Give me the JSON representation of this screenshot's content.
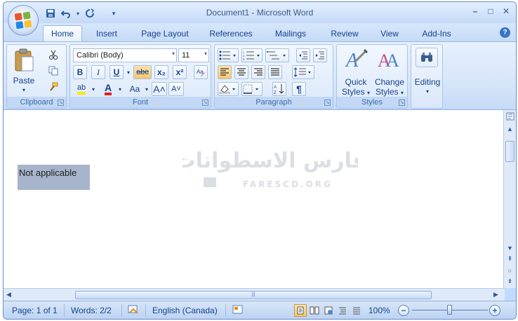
{
  "window": {
    "title": "Document1 - Microsoft Word",
    "controls": {
      "minimize": "–",
      "restore": "□",
      "close": "✕"
    }
  },
  "qat": {
    "more": "▾"
  },
  "tabs": [
    {
      "label": "Home",
      "active": true
    },
    {
      "label": "Insert"
    },
    {
      "label": "Page Layout"
    },
    {
      "label": "References"
    },
    {
      "label": "Mailings"
    },
    {
      "label": "Review"
    },
    {
      "label": "View"
    },
    {
      "label": "Add-Ins"
    }
  ],
  "help": "?",
  "ribbon": {
    "clipboard": {
      "label": "Clipboard",
      "paste": "Paste"
    },
    "font": {
      "label": "Font",
      "font_name": "Calibri (Body)",
      "font_size": "11",
      "bold": "B",
      "italic": "I",
      "underline": "U",
      "strike": "abc",
      "subscript": "x₂",
      "superscript": "x²",
      "change_case": "Aa",
      "grow": "A˄",
      "shrink": "A˅",
      "font_color": "A",
      "highlight": "ab"
    },
    "paragraph": {
      "label": "Paragraph",
      "pilcrow": "¶"
    },
    "styles": {
      "label": "Styles",
      "quick": "Quick",
      "quick2": "Styles",
      "change": "Change",
      "change2": "Styles"
    },
    "editing": {
      "label": "Editing"
    }
  },
  "document": {
    "text": "Not applicable"
  },
  "watermark": {
    "arabic": "فارس الاسطوانات",
    "latin": "FARESCD.ORG"
  },
  "statusbar": {
    "page": "Page: 1 of 1",
    "words": "Words: 2/2",
    "language": "English (Canada)",
    "zoom": "100%",
    "zoom_level": 0.5
  },
  "colors": {
    "accent": "#15428b",
    "ribbon": "#dbe8f9",
    "selection": "#a6b4cc"
  }
}
